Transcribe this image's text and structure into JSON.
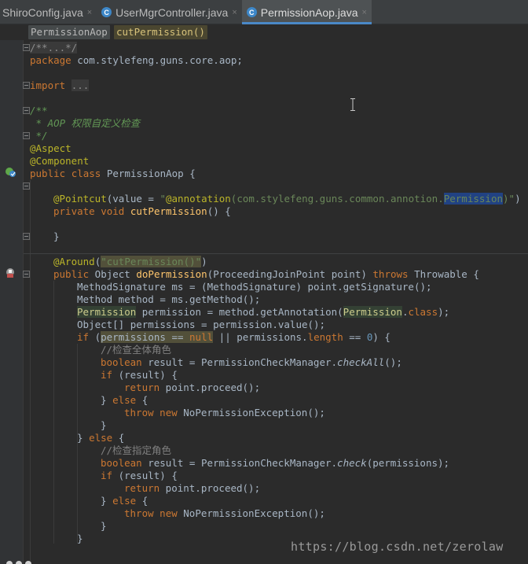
{
  "tabs": [
    {
      "label": "ShiroConfig.java",
      "close": "×",
      "icon": "none",
      "active": false
    },
    {
      "label": "UserMgrController.java",
      "close": "×",
      "icon": "C",
      "active": false
    },
    {
      "label": "PermissionAop.java",
      "close": "×",
      "icon": "C",
      "active": true
    }
  ],
  "breadcrumb": {
    "class_name": "PermissionAop",
    "method_name": "cutPermission()"
  },
  "code": {
    "l1": "/**...*/",
    "package_kw": "package",
    "package_name": " com.stylefeng.guns.core.aop;",
    "import_kw": "import",
    "import_fold": "...",
    "jd_open": "/**",
    "jd_line": " * AOP 权限自定义检查",
    "jd_close": " */",
    "ann_aspect": "@Aspect",
    "ann_component": "@Component",
    "public": "public",
    "class": "class",
    "class_name": "PermissionAop",
    "open_brace": "{",
    "pointcut_ann": "@Pointcut",
    "pointcut_a": "(value = ",
    "pointcut_str1": "\"",
    "pointcut_annot": "@annotation",
    "pointcut_pkg": "(com.stylefeng.guns.common.annotion.",
    "pointcut_perm": "Permission",
    "pointcut_close": ")",
    "pointcut_str2": "\"",
    "pointcut_end": ")",
    "private": "private",
    "void": "void",
    "cut_name": "cutPermission",
    "cut_rest": "() {",
    "close_brace": "}",
    "around_ann": "@Around",
    "around_open": "(",
    "around_str": "\"cutPermission()\"",
    "around_close": ")",
    "object": " Object ",
    "do_name": "doPermission",
    "do_params": "(ProceedingJoinPoint point) ",
    "throws": "throws",
    "throwable": " Throwable {",
    "ms_line": "MethodSignature ms = (MethodSignature) point.getSignature();",
    "method_line": "Method method = ms.getMethod();",
    "perm_type": "Permission",
    "perm_mid": " permission = method.getAnnotation(",
    "perm_type2": "Permission",
    "perm_dot": ".",
    "class_kw": "class",
    "perm_end": ");",
    "perms_line": "Object[] permissions = permission.value();",
    "if": "if",
    "if_a": " (",
    "if_perms": "permissions",
    "if_eq": " == ",
    "null": "null",
    "if_b": " || permissions.",
    "length": "length",
    "if_c": " == ",
    "zero": "0",
    "if_d": ") {",
    "cmt_all": "//检查全体角色",
    "boolean": "boolean",
    "result_a": " result = PermissionCheckManager.",
    "check_all": "checkAll",
    "result_end": "();",
    "if_result": " (result) {",
    "return": "return",
    "proceed": " point.proceed();",
    "else_close": "} ",
    "else": "else",
    "else_open": " {",
    "throw": "throw",
    "new": "new",
    "exception": " NoPermissionException();",
    "cmt_check": "//检查指定角色",
    "result_b": " result = PermissionCheckManager.",
    "check": "check",
    "check_args": "(permissions);"
  },
  "watermark": "https://blog.csdn.net/zerolaw",
  "icons": {
    "gutter_1": "spring-aop-bean-icon",
    "gutter_2": "aspect-advice-icon",
    "cursor": "text-cursor-icon"
  },
  "colors": {
    "keyword": "#cc7832",
    "string": "#6a8759",
    "annotation": "#bbb529",
    "number": "#6897bb",
    "method": "#ffc66d",
    "accent": "#4a88c7"
  }
}
